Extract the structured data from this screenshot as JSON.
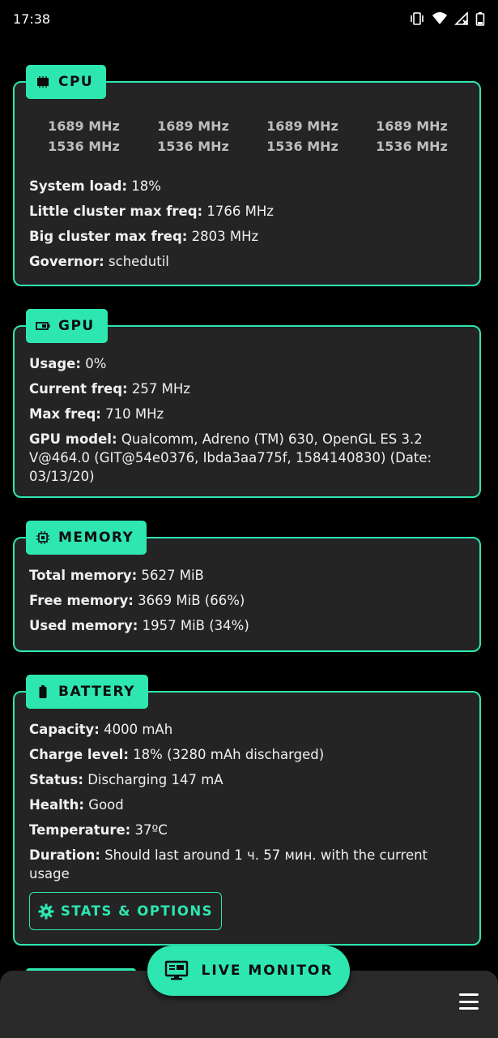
{
  "status_bar": {
    "time": "17:38",
    "icons": [
      "vibrate-icon",
      "wifi-icon",
      "signal-icon",
      "battery-icon"
    ]
  },
  "cpu": {
    "title": "CPU",
    "icon": "cpu-icon",
    "freqs_row1": [
      "1689 MHz",
      "1689 MHz",
      "1689 MHz",
      "1689 MHz"
    ],
    "freqs_row2": [
      "1536 MHz",
      "1536 MHz",
      "1536 MHz",
      "1536 MHz"
    ],
    "rows": [
      {
        "label": "System load:",
        "value": "18%"
      },
      {
        "label": "Little cluster max freq:",
        "value": "1766 MHz"
      },
      {
        "label": "Big cluster max freq:",
        "value": "2803 MHz"
      },
      {
        "label": "Governor:",
        "value": "schedutil"
      }
    ]
  },
  "gpu": {
    "title": "GPU",
    "icon": "gpu-icon",
    "rows": [
      {
        "label": "Usage:",
        "value": "0%"
      },
      {
        "label": "Current freq:",
        "value": "257 MHz"
      },
      {
        "label": "Max freq:",
        "value": "710 MHz"
      },
      {
        "label": "GPU model:",
        "value": "Qualcomm, Adreno (TM) 630, OpenGL ES 3.2 V@464.0 (GIT@54e0376, Ibda3aa775f, 1584140830) (Date: 03/13/20)"
      }
    ]
  },
  "memory": {
    "title": "MEMORY",
    "icon": "memory-chip-icon",
    "rows": [
      {
        "label": "Total memory:",
        "value": "5627 MiB"
      },
      {
        "label": "Free memory:",
        "value": "3669 MiB (66%)"
      },
      {
        "label": "Used memory:",
        "value": "1957 MiB (34%)"
      }
    ]
  },
  "battery": {
    "title": "BATTERY",
    "icon": "battery-icon",
    "rows": [
      {
        "label": "Capacity:",
        "value": "4000 mAh"
      },
      {
        "label": "Charge level:",
        "value": "18% (3280 mAh discharged)"
      },
      {
        "label": "Status:",
        "value": "Discharging 147 mA"
      },
      {
        "label": "Health:",
        "value": "Good"
      },
      {
        "label": "Temperature:",
        "value": "37ºC"
      },
      {
        "label": "Duration:",
        "value": "Should last around 1 ч. 57 мин. with the current usage"
      }
    ],
    "stats_button": "STATS & OPTIONS"
  },
  "fab": {
    "label": "LIVE MONITOR",
    "icon": "monitor-icon"
  },
  "menu": {
    "icon": "hamburger-menu-icon"
  },
  "colors": {
    "accent": "#2ee6b0",
    "card_bg": "#242424",
    "page_bg": "#000000"
  }
}
